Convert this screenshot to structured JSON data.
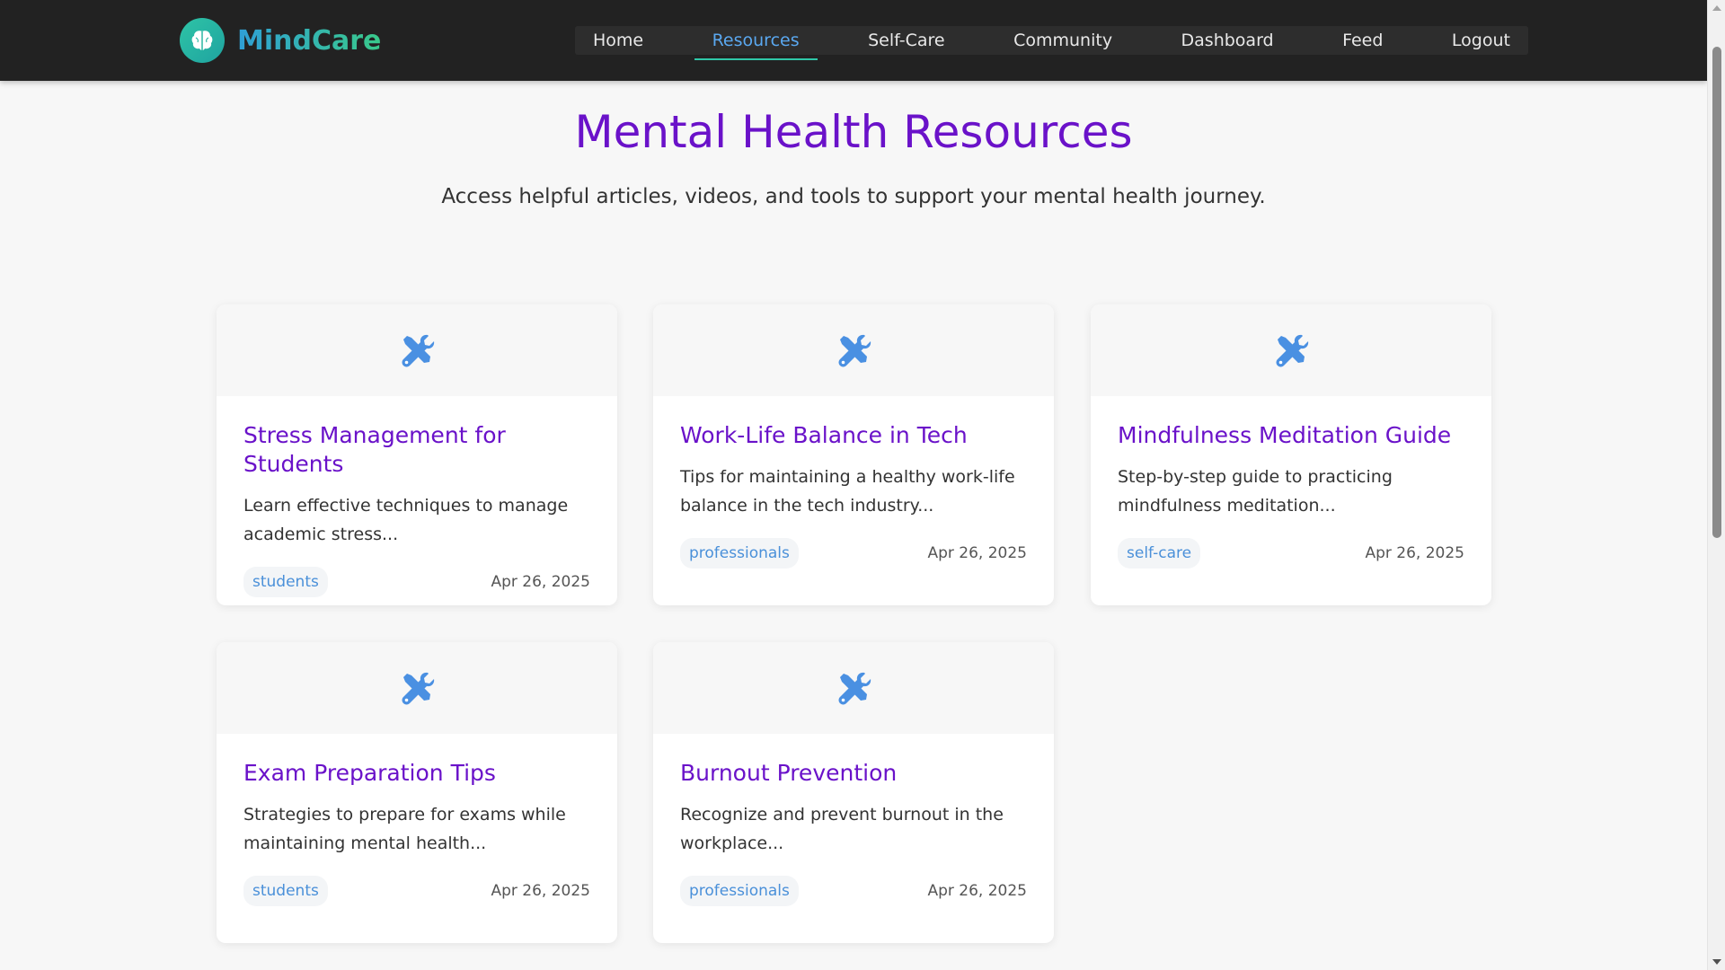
{
  "brand": {
    "name": "MindCare",
    "logo_icon": "brain-icon"
  },
  "nav": {
    "items": [
      {
        "label": "Home",
        "active": false
      },
      {
        "label": "Resources",
        "active": true
      },
      {
        "label": "Self-Care",
        "active": false
      },
      {
        "label": "Community",
        "active": false
      },
      {
        "label": "Dashboard",
        "active": false
      },
      {
        "label": "Feed",
        "active": false
      },
      {
        "label": "Logout",
        "active": false
      }
    ]
  },
  "hero": {
    "title": "Mental Health Resources",
    "subtitle": "Access helpful articles, videos, and tools to support your mental health journey."
  },
  "resources": [
    {
      "title": "Stress Management for Students",
      "description": "Learn effective techniques to manage academic stress...",
      "tag": "students",
      "date": "Apr 26, 2025",
      "icon": "tools-icon"
    },
    {
      "title": "Work-Life Balance in Tech",
      "description": "Tips for maintaining a healthy work-life balance in the tech industry...",
      "tag": "professionals",
      "date": "Apr 26, 2025",
      "icon": "tools-icon"
    },
    {
      "title": "Mindfulness Meditation Guide",
      "description": "Step-by-step guide to practicing mindfulness meditation...",
      "tag": "self-care",
      "date": "Apr 26, 2025",
      "icon": "tools-icon"
    },
    {
      "title": "Exam Preparation Tips",
      "description": "Strategies to prepare for exams while maintaining mental health...",
      "tag": "students",
      "date": "Apr 26, 2025",
      "icon": "tools-icon"
    },
    {
      "title": "Burnout Prevention",
      "description": "Recognize and prevent burnout in the workplace...",
      "tag": "professionals",
      "date": "Apr 26, 2025",
      "icon": "tools-icon"
    }
  ],
  "colors": {
    "header_bg": "#222222",
    "title_purple": "#6a12c9",
    "active_nav": "#5aa8f0",
    "icon_blue": "#4a90e2",
    "tag_text": "#4a90d9"
  }
}
